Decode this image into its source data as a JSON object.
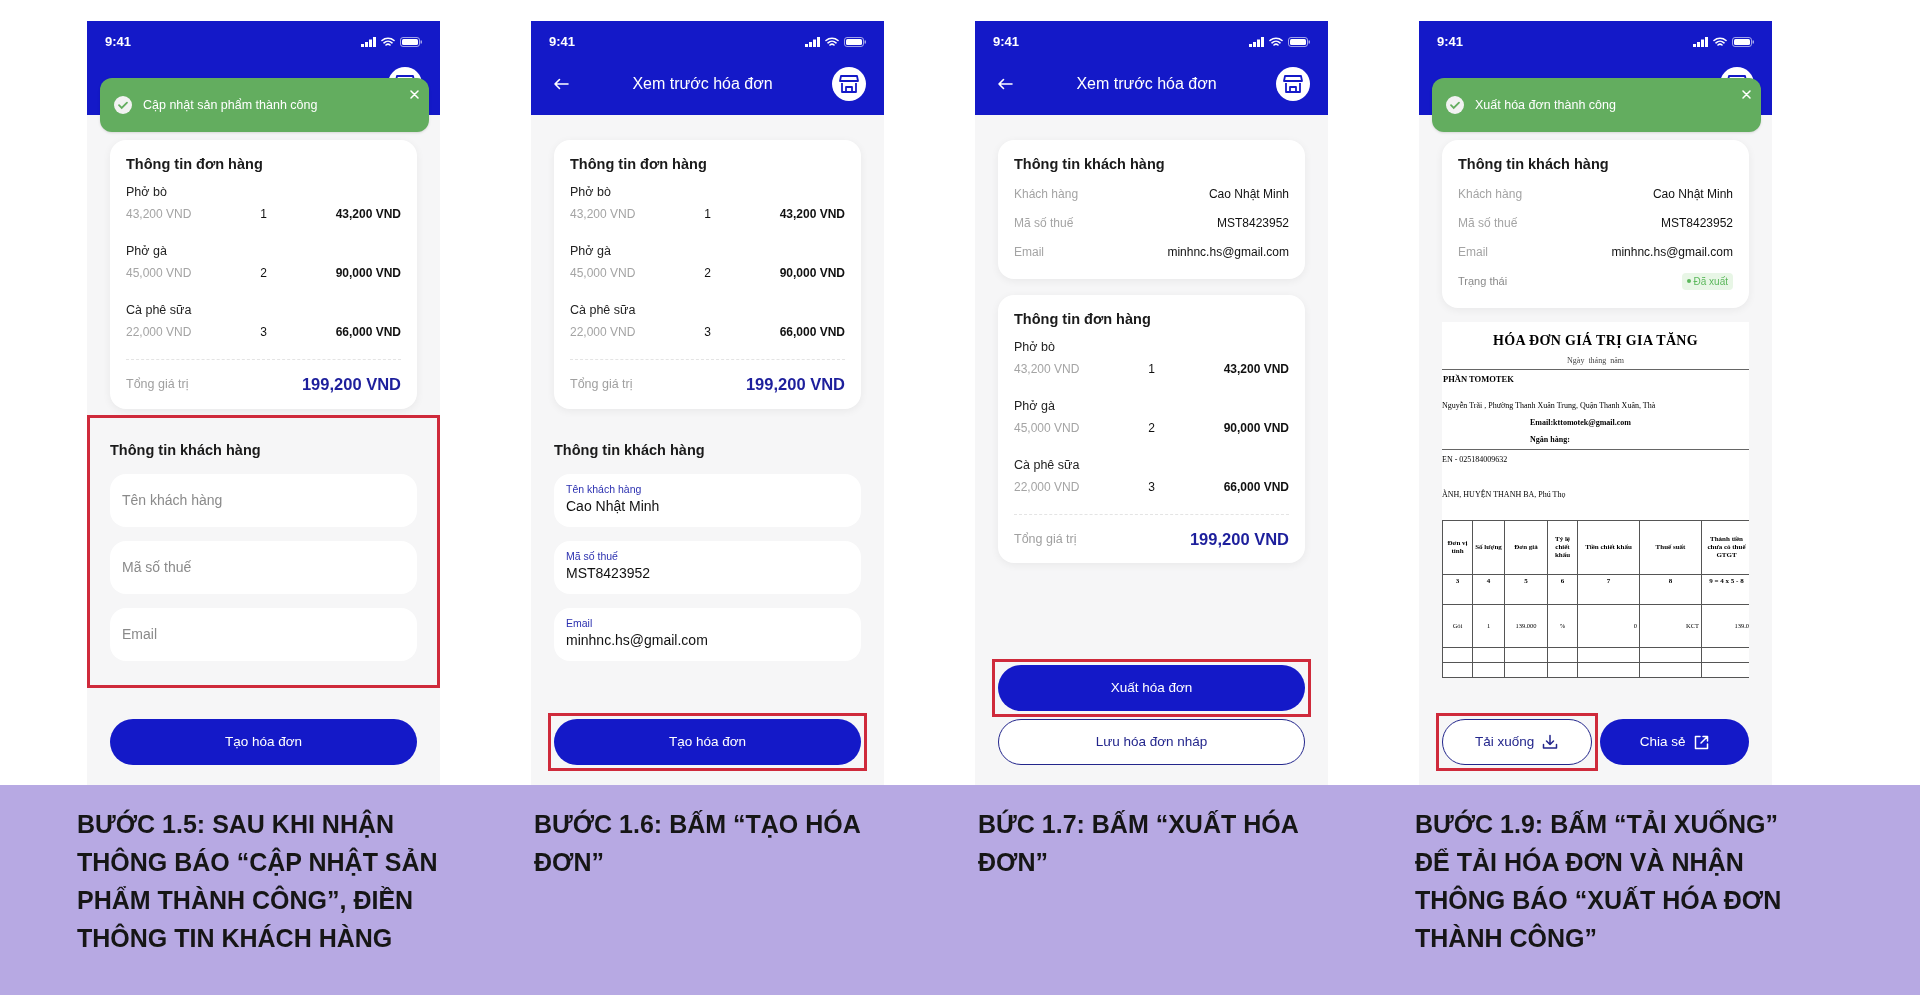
{
  "screens": [
    {
      "status_time": "9:41",
      "toast": {
        "text": "Cập nhật sản phẩm thành công"
      },
      "blocks": [
        {
          "kind": "order_card",
          "title": "Thông tin đơn hàng",
          "items": [
            {
              "name": "Phở bò",
              "unit_price": "43,200 VND",
              "quantity": "1",
              "amount": "43,200 VND"
            },
            {
              "name": "Phở gà",
              "unit_price": "45,000 VND",
              "quantity": "2",
              "amount": "90,000 VND"
            },
            {
              "name": "Cà phê sữa",
              "unit_price": "22,000 VND",
              "quantity": "3",
              "amount": "66,000 VND"
            }
          ],
          "total_label": "Tổng giá trị",
          "total_value": "199,200 VND"
        },
        {
          "kind": "customer_form",
          "title": "Thông tin khách hàng",
          "highlighted": true,
          "fields": [
            {
              "placeholder": "Tên khách hàng"
            },
            {
              "placeholder": "Mã số thuế"
            },
            {
              "placeholder": "Email"
            }
          ]
        },
        {
          "kind": "button_stack",
          "items": [
            {
              "label": "Tạo hóa đơn",
              "kind": "primary",
              "highlighted": false
            }
          ]
        }
      ],
      "caption": "BƯỚC 1.5: SAU KHI NHẬN THÔNG BÁO “CẬP NHẬT SẢN PHẨM THÀNH CÔNG”, ĐIỀN THÔNG TIN KHÁCH HÀNG"
    },
    {
      "status_time": "9:41",
      "header": {
        "title": "Xem trước hóa đơn"
      },
      "blocks": [
        {
          "kind": "order_card",
          "title": "Thông tin đơn hàng",
          "items": [
            {
              "name": "Phở bò",
              "unit_price": "43,200 VND",
              "quantity": "1",
              "amount": "43,200 VND"
            },
            {
              "name": "Phở gà",
              "unit_price": "45,000 VND",
              "quantity": "2",
              "amount": "90,000 VND"
            },
            {
              "name": "Cà phê sữa",
              "unit_price": "22,000 VND",
              "quantity": "3",
              "amount": "66,000 VND"
            }
          ],
          "total_label": "Tổng giá trị",
          "total_value": "199,200 VND"
        },
        {
          "kind": "customer_form",
          "title": "Thông tin khách hàng",
          "highlighted": false,
          "fields": [
            {
              "label": "Tên khách hàng",
              "value": "Cao Nhật Minh"
            },
            {
              "label": "Mã số thuế",
              "value": "MST8423952"
            },
            {
              "label": "Email",
              "value": "minhnc.hs@gmail.com"
            }
          ]
        },
        {
          "kind": "button_stack",
          "items": [
            {
              "label": "Tạo hóa đơn",
              "kind": "primary",
              "highlighted": true
            }
          ]
        }
      ],
      "caption": "BƯỚC 1.6: BẤM “TẠO HÓA ĐƠN”"
    },
    {
      "status_time": "9:41",
      "header": {
        "title": "Xem trước hóa đơn"
      },
      "blocks": [
        {
          "kind": "customer_card",
          "title": "Thông tin khách hàng",
          "rows": [
            {
              "label": "Khách hàng",
              "value": "Cao Nhật Minh"
            },
            {
              "label": "Mã số thuế",
              "value": "MST8423952"
            },
            {
              "label": "Email",
              "value": "minhnc.hs@gmail.com"
            }
          ]
        },
        {
          "kind": "order_card",
          "title": "Thông tin đơn hàng",
          "items": [
            {
              "name": "Phở bò",
              "unit_price": "43,200 VND",
              "quantity": "1",
              "amount": "43,200 VND"
            },
            {
              "name": "Phở gà",
              "unit_price": "45,000 VND",
              "quantity": "2",
              "amount": "90,000 VND"
            },
            {
              "name": "Cà phê sữa",
              "unit_price": "22,000 VND",
              "quantity": "3",
              "amount": "66,000 VND"
            }
          ],
          "total_label": "Tổng giá trị",
          "total_value": "199,200 VND"
        },
        {
          "kind": "button_stack",
          "items": [
            {
              "label": "Xuất hóa đơn",
              "kind": "primary",
              "highlighted": true
            },
            {
              "label": "Lưu hóa đơn nháp",
              "kind": "outline",
              "highlighted": false
            }
          ]
        }
      ],
      "caption": "BỨC 1.7: BẤM “XUẤT HÓA ĐƠN”"
    },
    {
      "status_time": "9:41",
      "toast": {
        "text": "Xuất hóa đơn thành công"
      },
      "blocks": [
        {
          "kind": "customer_card",
          "title": "Thông tin khách hàng",
          "rows": [
            {
              "label": "Khách hàng",
              "value": "Cao Nhật Minh"
            },
            {
              "label": "Mã số thuế",
              "value": "MST8423952"
            },
            {
              "label": "Email",
              "value": "minhnc.hs@gmail.com"
            }
          ],
          "status": {
            "label": "Trạng thái",
            "value": "Đã xuất",
            "color": "#5cb85c"
          }
        },
        {
          "kind": "invoice_document",
          "title": "HÓA ĐƠN GIÁ TRỊ GIA TĂNG",
          "date_line": "Ngày  tháng  năm",
          "company": "PHẦN TOMOTEK",
          "address": "Nguyễn Trãi , Phường Thanh Xuân Trung, Quận Thanh Xuân, Thà",
          "email": "Email:kttomotek@gmail.com",
          "bank": "Ngân hàng:",
          "tax_code": "EN - 025184009632",
          "customer_address": "ÀNH, HUYỆN THANH BA, Phú Thọ",
          "table": {
            "columns": [
              "Đơn vị tính",
              "Số lượng",
              "Đơn giá",
              "Tỷ lệ chiết khấu",
              "Tiền chiết khấu",
              "Thuế suất",
              "Thành tiền chưa có thuế GTGT"
            ],
            "number_row": [
              "3",
              "4",
              "5",
              "6",
              "7",
              "8",
              "9 = 4 x 5 - 8"
            ],
            "rows": [
              [
                "Gói",
                "1",
                "139.000",
                "%",
                "0",
                "KCT",
                "139.0"
              ]
            ]
          }
        },
        {
          "kind": "button_row",
          "items": [
            {
              "label": "Tải xuống",
              "kind": "download",
              "highlighted": true
            },
            {
              "label": "Chia sẻ",
              "kind": "share",
              "highlighted": false
            }
          ]
        }
      ],
      "caption": "BƯỚC 1.9: BẤM “TẢI XUỐNG” ĐỂ TẢI HÓA ĐƠN VÀ NHẬN THÔNG BÁO “XUẤT HÓA ĐƠN THÀNH CÔNG”"
    }
  ]
}
